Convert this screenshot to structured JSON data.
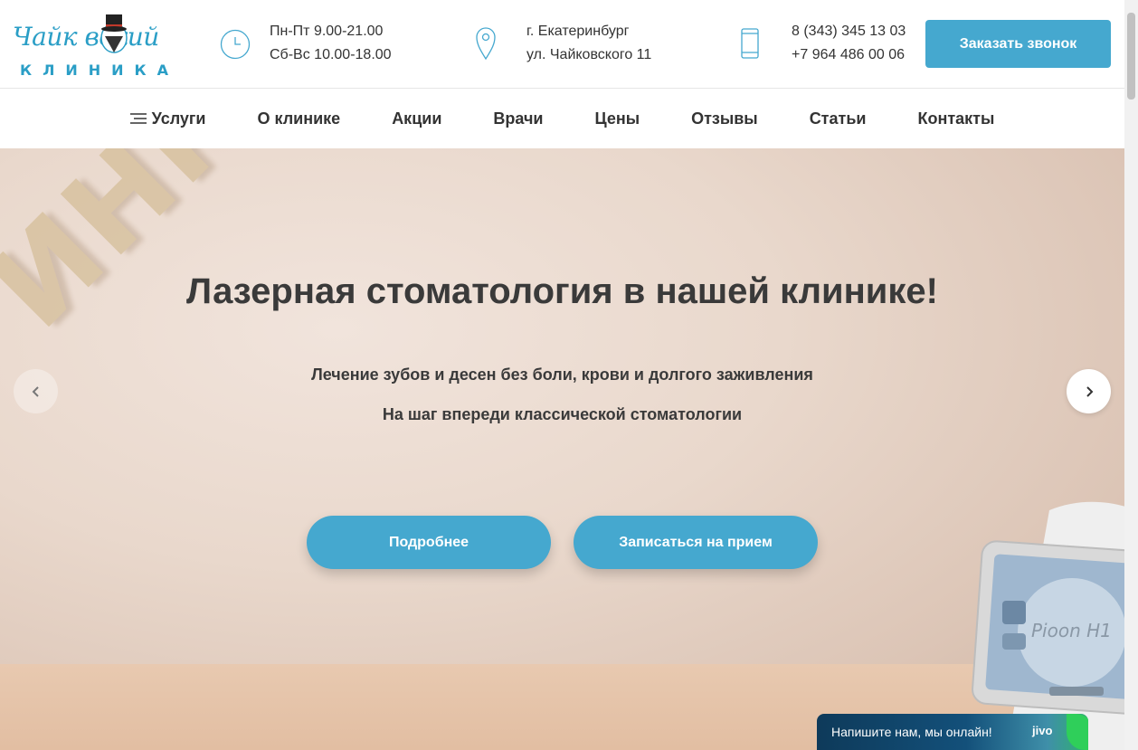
{
  "brand": {
    "script": "Чайк   вский",
    "sub": "КЛИНИКА"
  },
  "header": {
    "hours": [
      "Пн-Пт 9.00-21.00",
      "Сб-Вс 10.00-18.00"
    ],
    "address": [
      "г. Екатеринбург",
      "ул. Чайковского 11"
    ],
    "phones": [
      "8 (343) 345 13 03",
      "+7 964 486 00 06"
    ],
    "callback_label": "Заказать звонок"
  },
  "nav": {
    "items": [
      "Услуги",
      "О клинике",
      "Акции",
      "Врачи",
      "Цены",
      "Отзывы",
      "Статьи",
      "Контакты"
    ]
  },
  "hero": {
    "title": "Лазерная стоматология в нашей клинике!",
    "subtitle1": "Лечение зубов и десен без боли, крови и долгого заживления",
    "subtitle2": "На шаг впереди классической стоматологии",
    "btn_more": "Подробнее",
    "btn_book": "Записаться на прием",
    "bg_letters": "ИНКА",
    "device_label": "Pioon H1"
  },
  "chat": {
    "text": "Напишите нам, мы онлайн!",
    "brand": "jivo"
  },
  "colors": {
    "accent": "#45a8cf",
    "logo": "#2a9ec6",
    "text": "#333333"
  }
}
